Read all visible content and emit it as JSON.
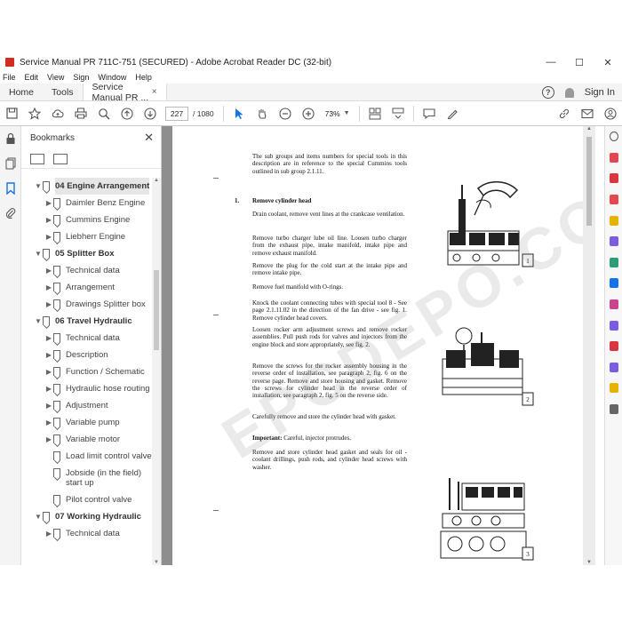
{
  "window": {
    "title": "Service Manual PR 711C-751 (SECURED) - Adobe Acrobat Reader DC (32-bit)",
    "controls": [
      "—",
      "☐",
      "✕"
    ]
  },
  "menu": [
    "File",
    "Edit",
    "View",
    "Sign",
    "Window",
    "Help"
  ],
  "tabs": {
    "home": "Home",
    "tools": "Tools",
    "document": "Service Manual PR ...",
    "close": "×",
    "help": "?",
    "signin": "Sign In"
  },
  "toolbar": {
    "current_page": "227",
    "total_pages": "/ 1080",
    "zoom": "73%"
  },
  "bookmarks": {
    "title": "Bookmarks",
    "close": "✕",
    "items": [
      {
        "level": 1,
        "expanded": true,
        "label": "04 Engine Arrangement"
      },
      {
        "level": 2,
        "expanded": false,
        "label": "Daimler Benz Engine"
      },
      {
        "level": 2,
        "expanded": false,
        "label": "Cummins Engine"
      },
      {
        "level": 2,
        "expanded": false,
        "label": "Liebherr Engine"
      },
      {
        "level": 1,
        "expanded": true,
        "label": "05 Splitter Box"
      },
      {
        "level": 2,
        "expanded": false,
        "label": "Technical data"
      },
      {
        "level": 2,
        "expanded": false,
        "label": "Arrangement"
      },
      {
        "level": 2,
        "expanded": false,
        "label": "Drawings Splitter box"
      },
      {
        "level": 1,
        "expanded": true,
        "label": "06 Travel Hydraulic"
      },
      {
        "level": 2,
        "expanded": false,
        "label": "Technical data"
      },
      {
        "level": 2,
        "expanded": false,
        "label": "Description"
      },
      {
        "level": 2,
        "expanded": false,
        "label": "Function / Schematic"
      },
      {
        "level": 2,
        "expanded": false,
        "label": "Hydraulic hose routing"
      },
      {
        "level": 2,
        "expanded": false,
        "label": "Adjustment"
      },
      {
        "level": 2,
        "expanded": false,
        "label": "Variable pump"
      },
      {
        "level": 2,
        "expanded": false,
        "label": "Variable motor"
      },
      {
        "level": 2,
        "expanded": null,
        "label": "Load limit control valve"
      },
      {
        "level": 2,
        "expanded": null,
        "label": "Jobside (in the field) start up"
      },
      {
        "level": 2,
        "expanded": null,
        "label": "Pilot control valve"
      },
      {
        "level": 1,
        "expanded": true,
        "label": "07 Working Hydraulic"
      },
      {
        "level": 2,
        "expanded": false,
        "label": "Technical data"
      }
    ]
  },
  "document": {
    "intro": "The sub groups and items numbers for special tools in this description are in reference to the special Cummins tools outlined in sub group 2.1.11.",
    "section_number": "1.",
    "section_title": "Remove cylinder head",
    "paragraphs": [
      "Drain coolant, remove vent lines at the crankcase ventilation.",
      "Remove turbo charger lube oil line. Loosen turbo charger from the exhaust pipe, intake manifold, intake pipe and remove exhaust manifold.",
      "Remove the plug for the cold start at the intake pipe and remove intake pipe.",
      "Remove fuel manifold with O-rings.",
      "Knock the coolant connecting tubes with special tool 8 - See page 2.1.11.02 in the direction of the fan drive - see fig. 1. Remove cylinder head covers.",
      "Loosen rocker arm adjustment screws and remove rocker assemblies. Pull push rods for valves and injectors from the engine block and store appropriately, see fig. 2.",
      "Remove the screws for the rocker assembly housing in the reverse order of installation, see paragraph 2, fig. 6 on the reverse page. Remove and store housing and gasket. Remove the screws for cylinder head in the reverse order of installation, see paragraph 2, fig. 5 on the reverse side.",
      "Carefully remove and store the cylinder head with gasket."
    ],
    "important_label": "Important:",
    "important_text": "Careful, injector protrudes.",
    "final_paragraph": "Remove and store cylinder head gasket and seals for oil - coolant drillings, push rods, and cylinder head screws with washer.",
    "figures": [
      "1",
      "2",
      "3"
    ],
    "watermark": "EPCDEPO.COM"
  },
  "colors": {
    "accent": "#1473e6",
    "app_icon": "#d42a1f",
    "doc_background": "#8e8e8e"
  }
}
